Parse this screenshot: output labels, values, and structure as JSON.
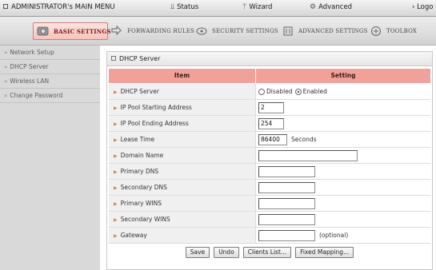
{
  "topbar": {
    "title": "ADMINISTRATOR's MAIN MENU",
    "status": "Status",
    "wizard": "Wizard",
    "advanced": "Advanced",
    "logout": "› Logo"
  },
  "tabs": [
    {
      "label": "BASIC SETTINGS",
      "icon": "basic-settings-icon",
      "active": true
    },
    {
      "label": "FORWARDING RULES",
      "icon": "forwarding-rules-icon",
      "active": false
    },
    {
      "label": "SECURITY SETTINGS",
      "icon": "security-settings-icon",
      "active": false
    },
    {
      "label": "ADVANCED SETTINGS",
      "icon": "advanced-settings-icon",
      "active": false
    },
    {
      "label": "TOOLBOX",
      "icon": "toolbox-icon",
      "active": false
    }
  ],
  "sidebar": {
    "items": [
      {
        "label": "Network Setup"
      },
      {
        "label": "DHCP Server"
      },
      {
        "label": "Wireless LAN"
      },
      {
        "label": "Change Password"
      }
    ]
  },
  "panel": {
    "title": "DHCP Server",
    "header_item": "Item",
    "header_setting": "Setting"
  },
  "form": {
    "dhcp_server": {
      "label": "DHCP Server",
      "disabled": "Disabled",
      "enabled": "Enabled",
      "selected": "Enabled"
    },
    "pool_start": {
      "label": "IP Pool Starting Address",
      "value": "2"
    },
    "pool_end": {
      "label": "IP Pool Ending Address",
      "value": "254"
    },
    "lease": {
      "label": "Lease Time",
      "value": "86400",
      "unit": "Seconds"
    },
    "domain": {
      "label": "Domain Name",
      "value": ""
    },
    "dns1": {
      "label": "Primary DNS",
      "value": ""
    },
    "dns2": {
      "label": "Secondary DNS",
      "value": ""
    },
    "wins1": {
      "label": "Primary WINS",
      "value": ""
    },
    "wins2": {
      "label": "Secondary WINS",
      "value": ""
    },
    "gateway": {
      "label": "Gateway",
      "value": "",
      "note": "(optional)"
    }
  },
  "buttons": {
    "save": "Save",
    "undo": "Undo",
    "clients": "Clients List...",
    "fixed": "Fixed Mapping..."
  },
  "colors": {
    "accent_header": "#f2a19a",
    "active_tab": "#f7c3bb",
    "sidebar_bg": "#d9d9d9"
  }
}
